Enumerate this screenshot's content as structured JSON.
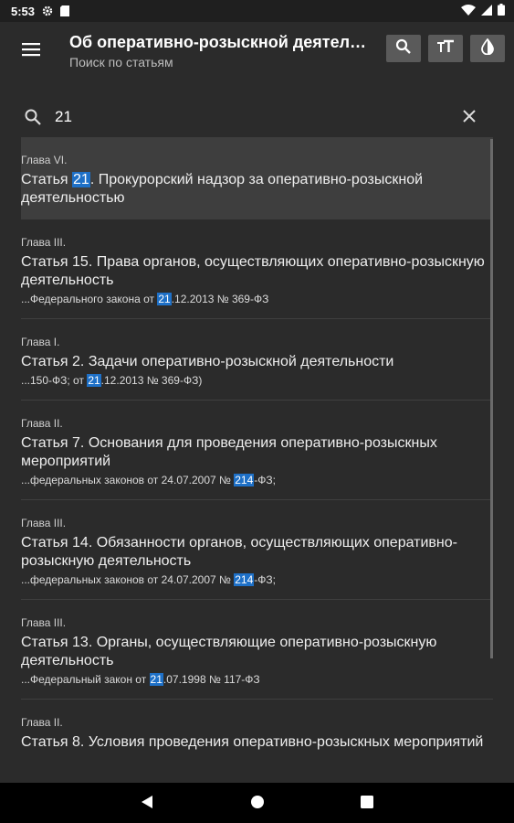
{
  "status": {
    "time": "5:53"
  },
  "header": {
    "title": "Об оперативно-розыскной деятельности",
    "subtitle": "Поиск по статьям"
  },
  "search": {
    "value": "21",
    "placeholder": ""
  },
  "results": [
    {
      "chapter": "Глава VI.",
      "title_pre": "Статья ",
      "title_hl": "21",
      "title_post": ". Прокурорский надзор за оперативно-розыскной деятельностью",
      "selected": true
    },
    {
      "chapter": "Глава III.",
      "title": "Статья 15. Права органов, осуществляющих оперативно-розыскную деятельность",
      "snip_pre": "...Федерального закона от ",
      "snip_hl": "21",
      "snip_post": ".12.2013 № 369-ФЗ"
    },
    {
      "chapter": "Глава I.",
      "title": "Статья 2. Задачи оперативно-розыскной деятельности",
      "snip_pre": "...150-ФЗ; от ",
      "snip_hl": "21",
      "snip_post": ".12.2013 № 369-ФЗ)"
    },
    {
      "chapter": "Глава II.",
      "title": "Статья 7. Основания для проведения оперативно-розыскных мероприятий",
      "snip_pre": "...федеральных законов от 24.07.2007 № ",
      "snip_hl": "214",
      "snip_post": "-ФЗ;"
    },
    {
      "chapter": "Глава III.",
      "title": "Статья 14. Обязанности органов, осуществляющих оперативно-розыскную деятельность",
      "snip_pre": "...федеральных законов от 24.07.2007 № ",
      "snip_hl": "214",
      "snip_post": "-ФЗ;"
    },
    {
      "chapter": "Глава III.",
      "title": "Статья 13. Органы, осуществляющие оперативно-розыскную деятельность",
      "snip_pre": "...Федеральный закон от ",
      "snip_hl": "21",
      "snip_post": ".07.1998 № 117-ФЗ"
    },
    {
      "chapter": "Глава II.",
      "title": "Статья 8. Условия проведения оперативно-розыскных мероприятий"
    }
  ],
  "icons": {
    "menu": "menu-icon",
    "search": "search-icon",
    "font_size": "text-size-icon",
    "theme": "contrast-icon",
    "clear": "close-icon"
  },
  "colors": {
    "highlight": "#1e70c7",
    "background": "#2b2b2b",
    "selected_row": "#3e3e3e"
  }
}
